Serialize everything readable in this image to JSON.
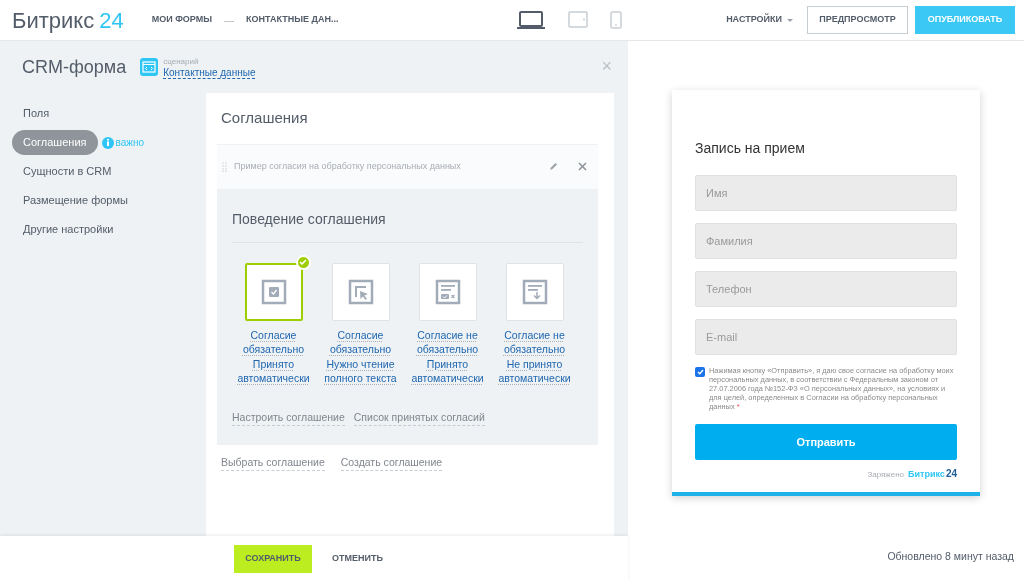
{
  "header": {
    "logo": {
      "name": "Битрикс",
      "number": "24"
    },
    "breadcrumbs": [
      "МОИ ФОРМЫ",
      "КОНТАКТНЫЕ ДАН..."
    ],
    "separator": "—",
    "devices": [
      {
        "kind": "laptop",
        "selected": true
      },
      {
        "kind": "tablet",
        "selected": false
      },
      {
        "kind": "phone",
        "selected": false
      }
    ],
    "settings": "НАСТРОЙКИ",
    "preview": "ПРЕДПРОСМОТР",
    "publish": "ОПУБЛИКОВАТЬ"
  },
  "editor": {
    "title": "CRM-форма",
    "scenario_label": "сценарий",
    "scenario": "Контактные данные",
    "close": "×"
  },
  "sidebar": {
    "items": [
      {
        "label": "Поля",
        "selected": false
      },
      {
        "label": "Соглашения",
        "selected": true,
        "badge": "важно"
      },
      {
        "label": "Сущности в CRM",
        "selected": false
      },
      {
        "label": "Размещение формы",
        "selected": false
      },
      {
        "label": "Другие настройки",
        "selected": false
      }
    ]
  },
  "agreements": {
    "title": "Соглашения",
    "item": "Пример согласия на обработку персональных данных",
    "behavior_title": "Поведение соглашения",
    "options": [
      {
        "kind": "checkbox",
        "label": "Согласие обязательно Принято автоматически",
        "selected": true
      },
      {
        "kind": "cursor",
        "label": "Согласие обязательно Нужно чтение полного текста",
        "selected": false
      },
      {
        "kind": "check-cross",
        "label": "Согласие не обязательно Принято автоматически",
        "selected": false
      },
      {
        "kind": "download",
        "label": "Согласие не обязательно Не принято автоматически",
        "selected": false
      }
    ],
    "links": [
      "Настроить соглашение",
      "Список принятых согласий"
    ],
    "bottom_links": [
      "Выбрать соглашение",
      "Создать соглашение"
    ]
  },
  "footer": {
    "save": "СОХРАНИТЬ",
    "cancel": "ОТМЕНИТЬ",
    "updated": "Обновлено 8 минут назад"
  },
  "preview_form": {
    "title": "Запись на прием",
    "fields": [
      {
        "placeholder": "Имя"
      },
      {
        "placeholder": "Фамилия"
      },
      {
        "placeholder": "Телефон"
      },
      {
        "placeholder": "E-mail"
      }
    ],
    "consent": {
      "checked": true,
      "text": "Нажимая кнопку «Отправить», я даю свое согласие на обработку моих персональных данных, в соответствии с Федеральным законом от 27.07.2006 года №152-ФЗ «О персональных данных», на условиях и для целей, определенных в Согласии на обработку персональных данных",
      "required": "*"
    },
    "submit": "Отправить",
    "powered_by": "Заряжено",
    "brand": "Битрикс",
    "brand_number": "24"
  }
}
